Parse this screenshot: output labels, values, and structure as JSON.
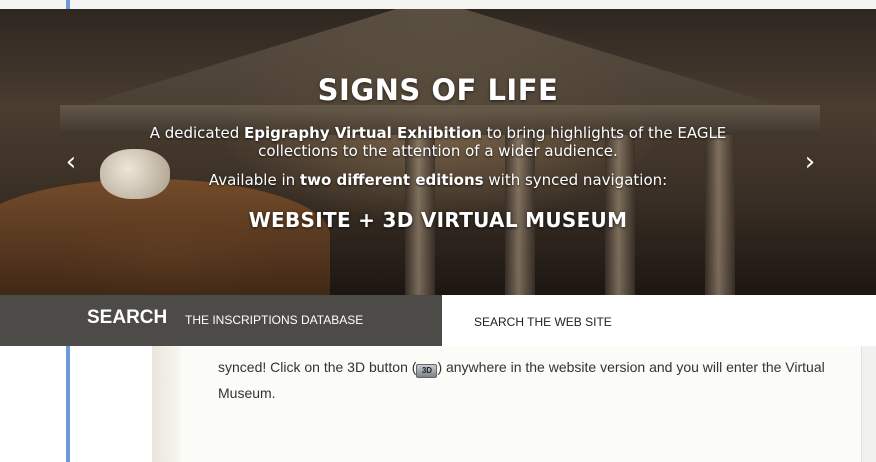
{
  "hero": {
    "title": "SIGNS OF LIFE",
    "line1_pre": "A dedicated ",
    "line1_bold": "Epigraphy Virtual Exhibition",
    "line1_post": " to bring highlights of the EAGLE",
    "line2": "collections to the attention of a wider audience.",
    "line3_pre": "Available in ",
    "line3_bold": "two different editions",
    "line3_post": " with synced navigation:",
    "edition": "WEBSITE + 3D VIRTUAL MUSEUM",
    "prev_arrow": "‹",
    "next_arrow": "›"
  },
  "search": {
    "label": "SEARCH",
    "database_link": "THE INSCRIPTIONS DATABASE",
    "site_link": "SEARCH THE WEB SITE"
  },
  "body": {
    "text_pre": "synced! Click on the 3D button (",
    "text_post": ") anywhere in the website version and you will enter the Virtual Museum.",
    "button_3d_icon": "3d-button-icon"
  },
  "colors": {
    "search_bar_dark": "#4c4b47",
    "left_rail_accent": "#6b9ad6"
  }
}
